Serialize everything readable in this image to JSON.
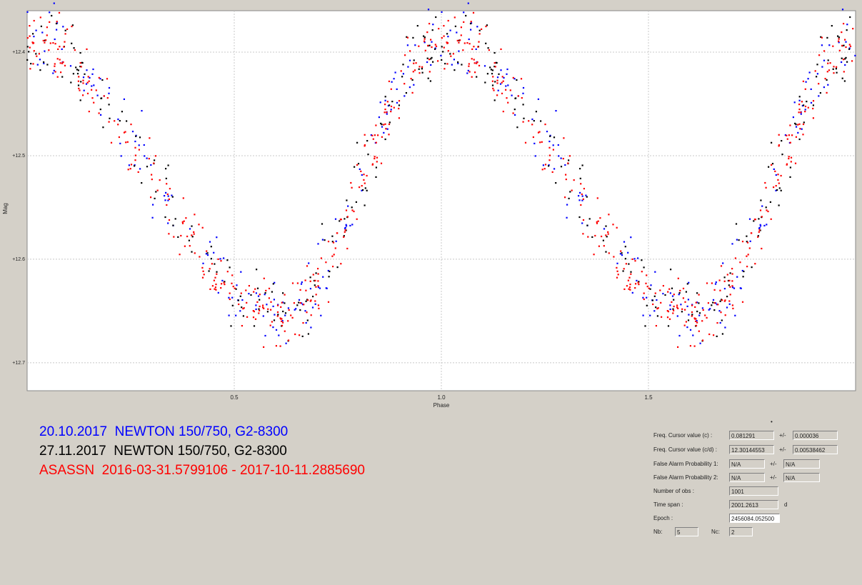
{
  "chart_data": {
    "type": "scatter",
    "xlabel": "Phase",
    "ylabel": "Mag",
    "xlim": [
      0,
      2
    ],
    "ylim": [
      12.36,
      12.727
    ],
    "y_inverted": true,
    "grid": true,
    "x_ticks": [
      {
        "value": 0.5,
        "label": "0.5"
      },
      {
        "value": 1.0,
        "label": "1.0"
      },
      {
        "value": 1.5,
        "label": "1.5"
      }
    ],
    "y_ticks": [
      {
        "value": 12.4,
        "label": "+12.4"
      },
      {
        "value": 12.5,
        "label": "+12.5"
      },
      {
        "value": 12.6,
        "label": "+12.6"
      },
      {
        "value": 12.7,
        "label": "+12.7"
      }
    ],
    "model": {
      "max_mag": 12.39,
      "min_mag": 12.655,
      "max_phase": 0.0,
      "min_phase": 0.62,
      "scatter": 0.016
    },
    "series": [
      {
        "name": "20.10.2017  NEWTON 150/750, G2-8300",
        "color": "#0000ff",
        "count": 170
      },
      {
        "name": "27.11.2017  NEWTON 150/750, G2-8300",
        "color": "#000000",
        "count": 170
      },
      {
        "name": "ASASSN  2016-03-31.5799106 - 2017-10-11.2885690",
        "color": "#ff0000",
        "count": 330
      }
    ]
  },
  "legend": {
    "blue": "20.10.2017  NEWTON 150/750, G2-8300",
    "black": "27.11.2017  NEWTON 150/750, G2-8300",
    "red": "ASASSN  2016-03-31.5799106 - 2017-10-11.2885690",
    "colors": {
      "blue": "#0000ff",
      "black": "#000000",
      "red": "#ff0000"
    }
  },
  "info_panel": {
    "dot_mark": "•",
    "freq_c": {
      "label": "Freq. Cursor value (c) :",
      "value": "0.081291",
      "pm": "+/-",
      "err": "0.000036"
    },
    "freq_cd": {
      "label": "Freq. Cursor value (c/d) :",
      "value": "12.30144553",
      "pm": "+/-",
      "err": "0.00538462"
    },
    "fap1": {
      "label": "False Alarm Probability 1:",
      "value": "N/A",
      "pm": "+/-",
      "err": "N/A"
    },
    "fap2": {
      "label": "False Alarm Probability 2:",
      "value": "N/A",
      "pm": "+/-",
      "err": "N/A"
    },
    "nobs": {
      "label": "Number of obs :",
      "value": "1001"
    },
    "timespan": {
      "label": "Time span :",
      "value": "2001.2613",
      "unit": "d"
    },
    "epoch": {
      "label": "Epoch :",
      "value": "2456084.052500"
    },
    "nb": {
      "label": "Nb:",
      "value": "5"
    },
    "nc": {
      "label": "Nc:",
      "value": "2"
    }
  }
}
